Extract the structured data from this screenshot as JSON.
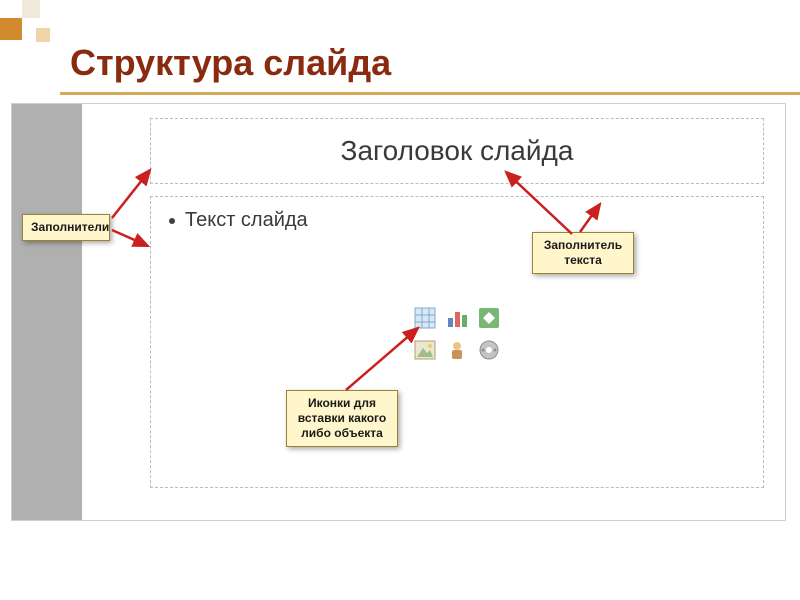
{
  "page": {
    "title": "Структура слайда"
  },
  "slide": {
    "title_placeholder": "Заголовок слайда",
    "body_bullet": "Текст слайда"
  },
  "callouts": {
    "placeholders": "Заполнители",
    "text_fill": "Заполнитель текста",
    "icons": "Иконки для вставки какого либо объекта"
  },
  "icons": {
    "table": "table-icon",
    "chart": "chart-icon",
    "smartart": "smartart-icon",
    "picture": "picture-icon",
    "clipart": "clipart-icon",
    "media": "media-icon"
  }
}
